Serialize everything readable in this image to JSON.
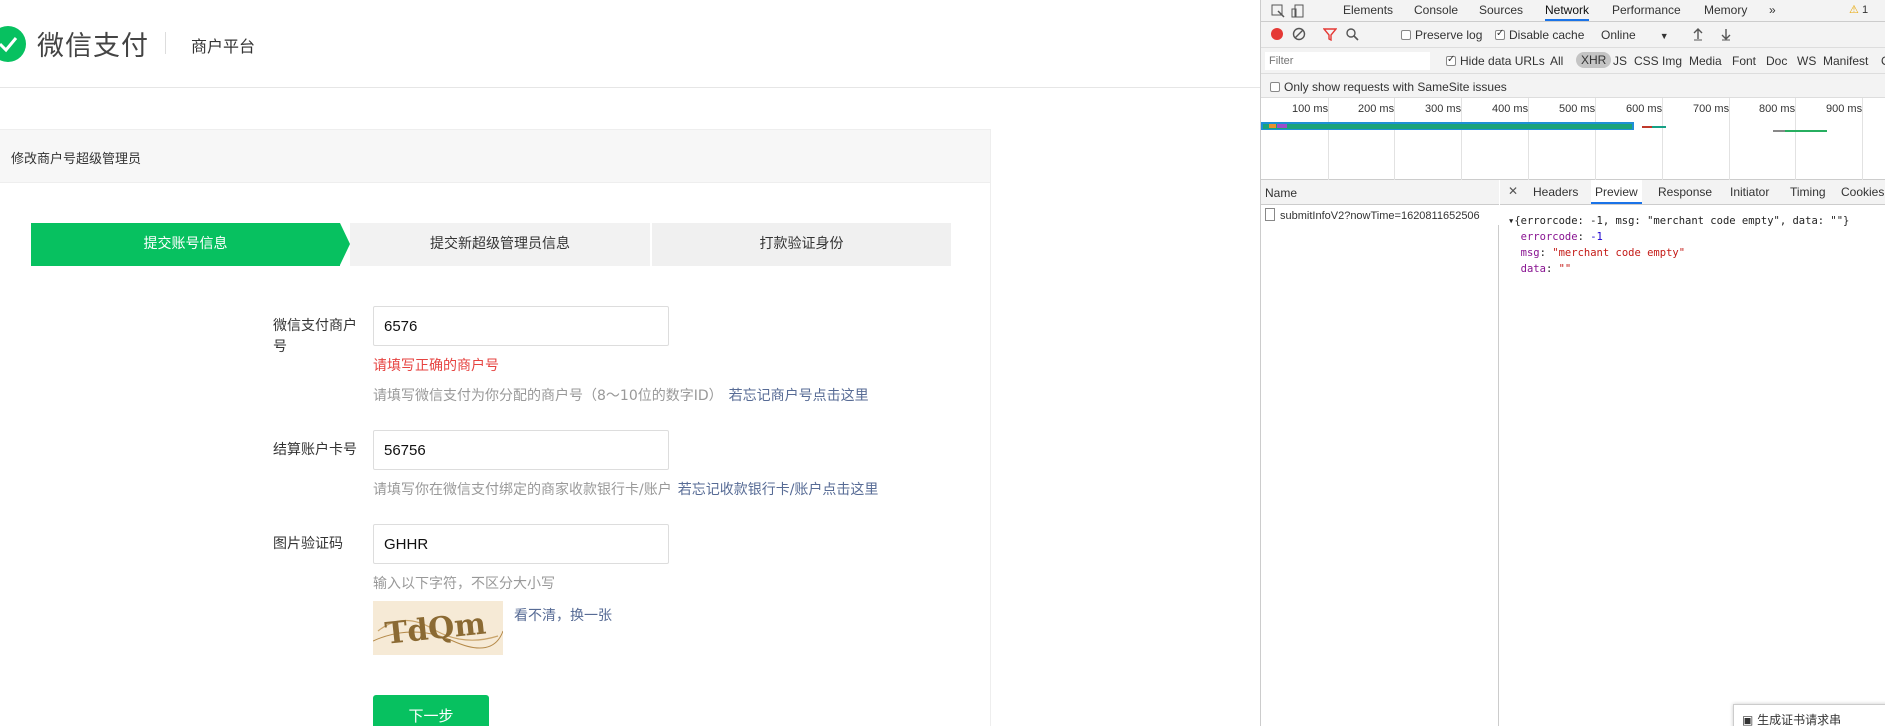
{
  "header": {
    "logo_text": "微信支付",
    "platform": "商户平台"
  },
  "panel": {
    "title": "修改商户号超级管理员"
  },
  "steps": [
    {
      "label": "提交账号信息",
      "active": true
    },
    {
      "label": "提交新超级管理员信息",
      "active": false
    },
    {
      "label": "打款验证身份",
      "active": false
    }
  ],
  "form": {
    "merchant": {
      "label": "微信支付商户号",
      "value": "6576",
      "error": "请填写正确的商户号",
      "hint": "请填写微信支付为你分配的商户号（8～10位的数字ID）",
      "hint_link": "若忘记商户号点击这里"
    },
    "account": {
      "label": "结算账户卡号",
      "value": "56756",
      "hint": "请填写你在微信支付绑定的商家收款银行卡/账户",
      "hint_link": "若忘记收款银行卡/账户点击这里"
    },
    "captcha": {
      "label": "图片验证码",
      "value": "GHHR",
      "hint": "输入以下字符，不区分大小写",
      "image_text": "TdQm",
      "refresh_link": "看不清，换一张"
    },
    "next_button": "下一步"
  },
  "devtools": {
    "tabs": [
      "Elements",
      "Console",
      "Sources",
      "Network",
      "Performance",
      "Memory"
    ],
    "active_tab": "Network",
    "more": "»",
    "warning_count": "1",
    "toolbar": {
      "preserve_log": "Preserve log",
      "disable_cache": "Disable cache",
      "throttle": "Online"
    },
    "filter": {
      "placeholder": "Filter",
      "hide_data_urls": "Hide data URLs",
      "types": [
        "All",
        "XHR",
        "JS",
        "CSS",
        "Img",
        "Media",
        "Font",
        "Doc",
        "WS",
        "Manifest",
        "O"
      ],
      "active_type": "XHR"
    },
    "samesite": "Only show requests with SameSite issues",
    "timeline_labels": [
      "100 ms",
      "200 ms",
      "300 ms",
      "400 ms",
      "500 ms",
      "600 ms",
      "700 ms",
      "800 ms",
      "900 ms"
    ],
    "name_header": "Name",
    "request_name": "submitInfoV2?nowTime=1620811652506",
    "detail_tabs": [
      "Headers",
      "Preview",
      "Response",
      "Initiator",
      "Timing",
      "Cookies"
    ],
    "active_detail_tab": "Preview",
    "preview": {
      "summary": "{errorcode: -1, msg: \"merchant code empty\", data: \"\"}",
      "errorcode_key": "errorcode",
      "errorcode_val": "-1",
      "msg_key": "msg",
      "msg_val": "\"merchant code empty\"",
      "data_key": "data",
      "data_val": "\"\""
    },
    "cert_tip": "生成证书请求串"
  },
  "colors": {
    "brand_green": "#07c160",
    "error_red": "#e64340",
    "link_blue": "#576b95",
    "devtools_active": "#1a73e8"
  }
}
